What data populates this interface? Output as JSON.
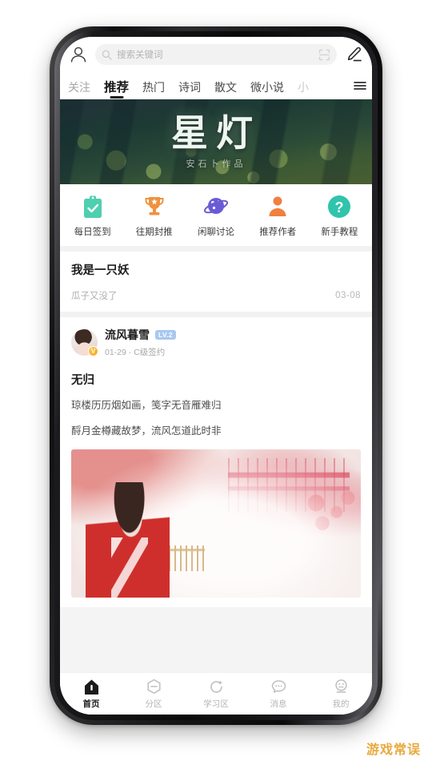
{
  "topbar": {
    "profile_icon": "person-icon",
    "search_placeholder": "搜索关键词",
    "search_icon": "search-icon",
    "scan_icon": "scan-icon",
    "compose_icon": "pencil-edit-icon"
  },
  "tabs": {
    "menu_icon": "hamburger-menu-icon",
    "items": [
      {
        "label": "关注",
        "active": false
      },
      {
        "label": "推荐",
        "active": true
      },
      {
        "label": "热门",
        "active": false
      },
      {
        "label": "诗词",
        "active": false
      },
      {
        "label": "散文",
        "active": false
      },
      {
        "label": "微小说",
        "active": false
      },
      {
        "label": "小",
        "active": false
      }
    ]
  },
  "banner": {
    "title": "星灯",
    "subtitle": "安石卜作品"
  },
  "quick_actions": [
    {
      "label": "每日签到",
      "icon": "clipboard-check-icon",
      "color": "#4ecfb0"
    },
    {
      "label": "往期封推",
      "icon": "trophy-icon",
      "color": "#f0923f"
    },
    {
      "label": "闲聊讨论",
      "icon": "planet-icon",
      "color": "#6a5bd6"
    },
    {
      "label": "推荐作者",
      "icon": "person-filled-icon",
      "color": "#f08040"
    },
    {
      "label": "新手教程",
      "icon": "question-circle-icon",
      "color": "#2fc4ac"
    }
  ],
  "feed": {
    "post1": {
      "title": "我是一只妖",
      "author": "瓜子又没了",
      "date": "03-08"
    },
    "post2": {
      "user_name": "流风暮雪",
      "level_badge": "LV.2",
      "verified_mark": "V",
      "date": "01-29",
      "separator": "·",
      "contract": "C级签约",
      "title": "无归",
      "line1": "琼楼历历烟如画，笺字无音雁难归",
      "line2": "酹月金樽藏故梦，流风怎道此时非",
      "image_alt": "红衣古风女子与粉红楼阁插画"
    }
  },
  "bottom_nav": [
    {
      "label": "首页",
      "icon": "home-icon",
      "active": true
    },
    {
      "label": "分区",
      "icon": "hexagon-icon",
      "active": false
    },
    {
      "label": "学习区",
      "icon": "refresh-circle-icon",
      "active": false
    },
    {
      "label": "消息",
      "icon": "chat-bubble-icon",
      "active": false
    },
    {
      "label": "我的",
      "icon": "face-icon",
      "active": false
    }
  ],
  "watermark": "游戏常误",
  "colors": {
    "accent_dark": "#1a1a1a",
    "badge_blue": "#a8c8f0",
    "verified_orange": "#f5a623",
    "watermark": "#e8a93c"
  }
}
